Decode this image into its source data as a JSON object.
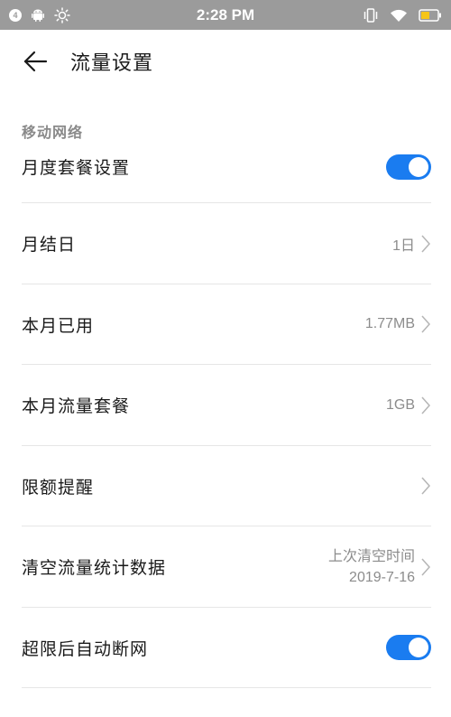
{
  "status_bar": {
    "notification_count": "4",
    "time": "2:28 PM",
    "icons": [
      "android-icon",
      "brightness-icon",
      "vibrate-icon",
      "wifi-icon",
      "battery-icon"
    ],
    "battery_color": "#f5c518"
  },
  "header": {
    "back_icon": "back-arrow-icon",
    "title": "流量设置"
  },
  "section": {
    "title": "移动网络"
  },
  "rows": [
    {
      "label": "月度套餐设置",
      "type": "toggle",
      "on": true
    },
    {
      "label": "月结日",
      "value": "1日",
      "type": "nav"
    },
    {
      "label": "本月已用",
      "value": "1.77MB",
      "type": "nav"
    },
    {
      "label": "本月流量套餐",
      "value": "1GB",
      "type": "nav"
    },
    {
      "label": "限额提醒",
      "value": "",
      "type": "nav"
    },
    {
      "label": "清空流量统计数据",
      "value_line1": "上次清空时间",
      "value_line2": "2019-7-16",
      "type": "nav"
    },
    {
      "label": "超限后自动断网",
      "type": "toggle",
      "on": true
    }
  ],
  "colors": {
    "accent": "#1a7cf0",
    "status_bar_bg": "#9b9b9b",
    "secondary_text": "#8c8c8c"
  }
}
